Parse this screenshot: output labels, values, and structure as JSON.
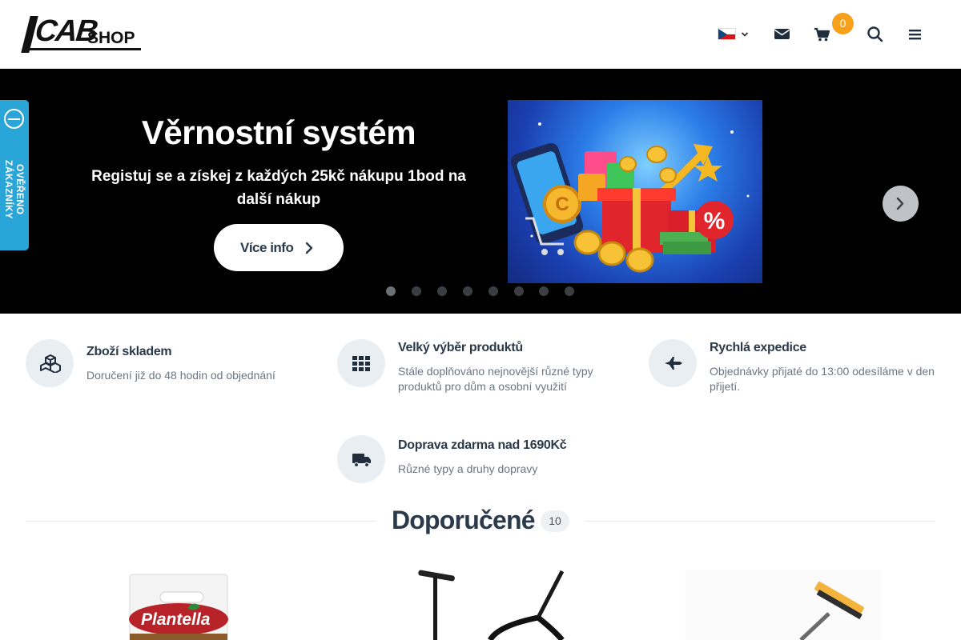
{
  "header": {
    "logo_text_main": "CAB",
    "logo_text_sub": "SHOP",
    "cart_count": "0",
    "language": "cs"
  },
  "slider": {
    "title": "Věrnostní systém",
    "subtitle": "Registuj se a získej z každých 25kč nákupu 1bod na další nákup",
    "button_label": "Více info",
    "dots_total": 8,
    "active_dot": 1
  },
  "verified_badge": {
    "text": "OVĚŘENO ZÁKAZNÍKY"
  },
  "features": [
    {
      "title": "Zboží skladem",
      "desc": "Doručení již do 48 hodin od objednání",
      "icon": "boxes-icon"
    },
    {
      "title": "Velký výběr produktů",
      "desc": "Stále doplňováno nejnovější různé typy produktů pro dům a osobní využití",
      "icon": "grid-icon"
    },
    {
      "title": "Rychlá expedice",
      "desc": "Objednávky přijaté do 13:00 odesíláme v den přijetí.",
      "icon": "plane-icon"
    },
    {
      "title": "Doprava zdarma nad 1690Kč",
      "desc": "Různé typy a druhy dopravy",
      "icon": "truck-icon"
    }
  ],
  "recommended": {
    "title": "Doporučené",
    "count": "10"
  },
  "products": [
    {
      "image_label": "Plantella"
    },
    {
      "image_label": ""
    },
    {
      "image_label": ""
    }
  ],
  "colors": {
    "accent": "#f7a11a",
    "text": "#2b3a4a",
    "verified": "#2aa5d8",
    "slider_bg": "#000000"
  }
}
